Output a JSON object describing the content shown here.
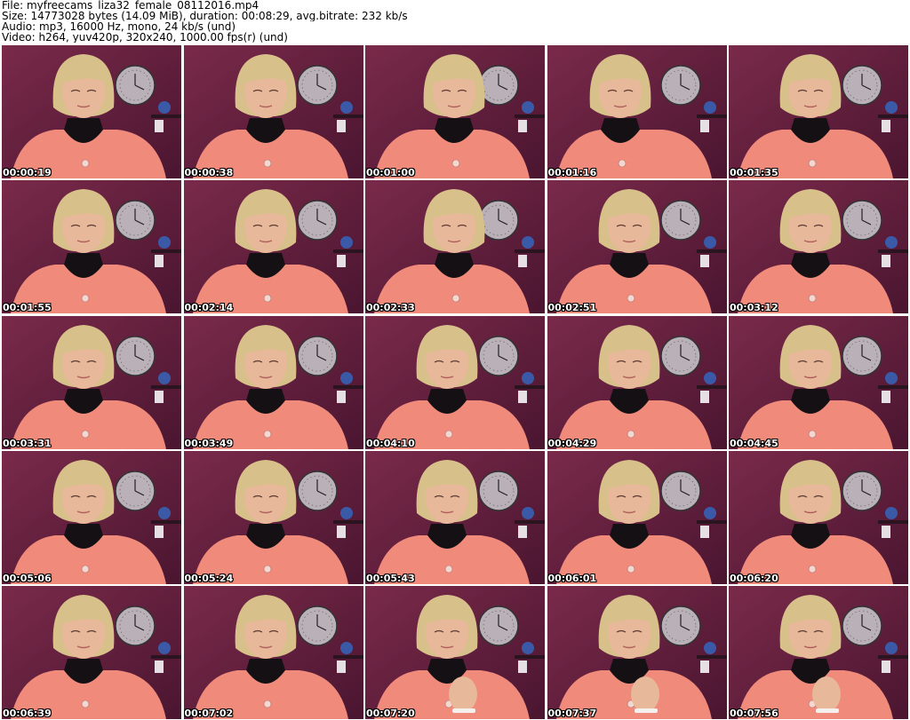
{
  "header": {
    "file_line": "File: myfreecams_liza32_female_08112016.mp4",
    "size_line": "Size: 14773028 bytes (14.09 MiB), duration: 00:08:29, avg.bitrate: 232 kb/s",
    "audio_line": "Audio: mp3, 16000 Hz, mono, 24 kb/s (und)",
    "video_line": "Video: h264, yuv420p, 320x240, 1000.00 fps(r) (und)"
  },
  "colors": {
    "wall": "#7a2a4a",
    "wall_dark": "#4a1530",
    "sweater": "#f08a7a",
    "hair": "#d8c08a",
    "skin": "#e8b89a",
    "collar": "#141014"
  },
  "thumbnails": [
    {
      "time": "00:00:19",
      "pose": "center",
      "hand": false
    },
    {
      "time": "00:00:38",
      "pose": "center",
      "hand": false
    },
    {
      "time": "00:01:00",
      "pose": "right",
      "hand": false
    },
    {
      "time": "00:01:16",
      "pose": "left",
      "hand": false
    },
    {
      "time": "00:01:35",
      "pose": "center",
      "hand": false
    },
    {
      "time": "00:01:55",
      "pose": "center",
      "hand": false
    },
    {
      "time": "00:02:14",
      "pose": "center",
      "hand": false
    },
    {
      "time": "00:02:33",
      "pose": "right",
      "hand": false
    },
    {
      "time": "00:02:51",
      "pose": "center",
      "hand": false
    },
    {
      "time": "00:03:12",
      "pose": "center",
      "hand": false
    },
    {
      "time": "00:03:31",
      "pose": "center",
      "hand": false
    },
    {
      "time": "00:03:49",
      "pose": "center",
      "hand": false
    },
    {
      "time": "00:04:10",
      "pose": "center",
      "hand": false
    },
    {
      "time": "00:04:29",
      "pose": "center",
      "hand": false
    },
    {
      "time": "00:04:45",
      "pose": "center",
      "hand": false
    },
    {
      "time": "00:05:06",
      "pose": "center",
      "hand": false
    },
    {
      "time": "00:05:24",
      "pose": "center",
      "hand": false
    },
    {
      "time": "00:05:43",
      "pose": "center",
      "hand": false
    },
    {
      "time": "00:06:01",
      "pose": "center",
      "hand": false
    },
    {
      "time": "00:06:20",
      "pose": "center",
      "hand": false
    },
    {
      "time": "00:06:39",
      "pose": "center",
      "hand": false
    },
    {
      "time": "00:07:02",
      "pose": "center",
      "hand": false
    },
    {
      "time": "00:07:20",
      "pose": "center",
      "hand": true
    },
    {
      "time": "00:07:37",
      "pose": "center",
      "hand": true
    },
    {
      "time": "00:07:56",
      "pose": "center",
      "hand": true
    }
  ]
}
